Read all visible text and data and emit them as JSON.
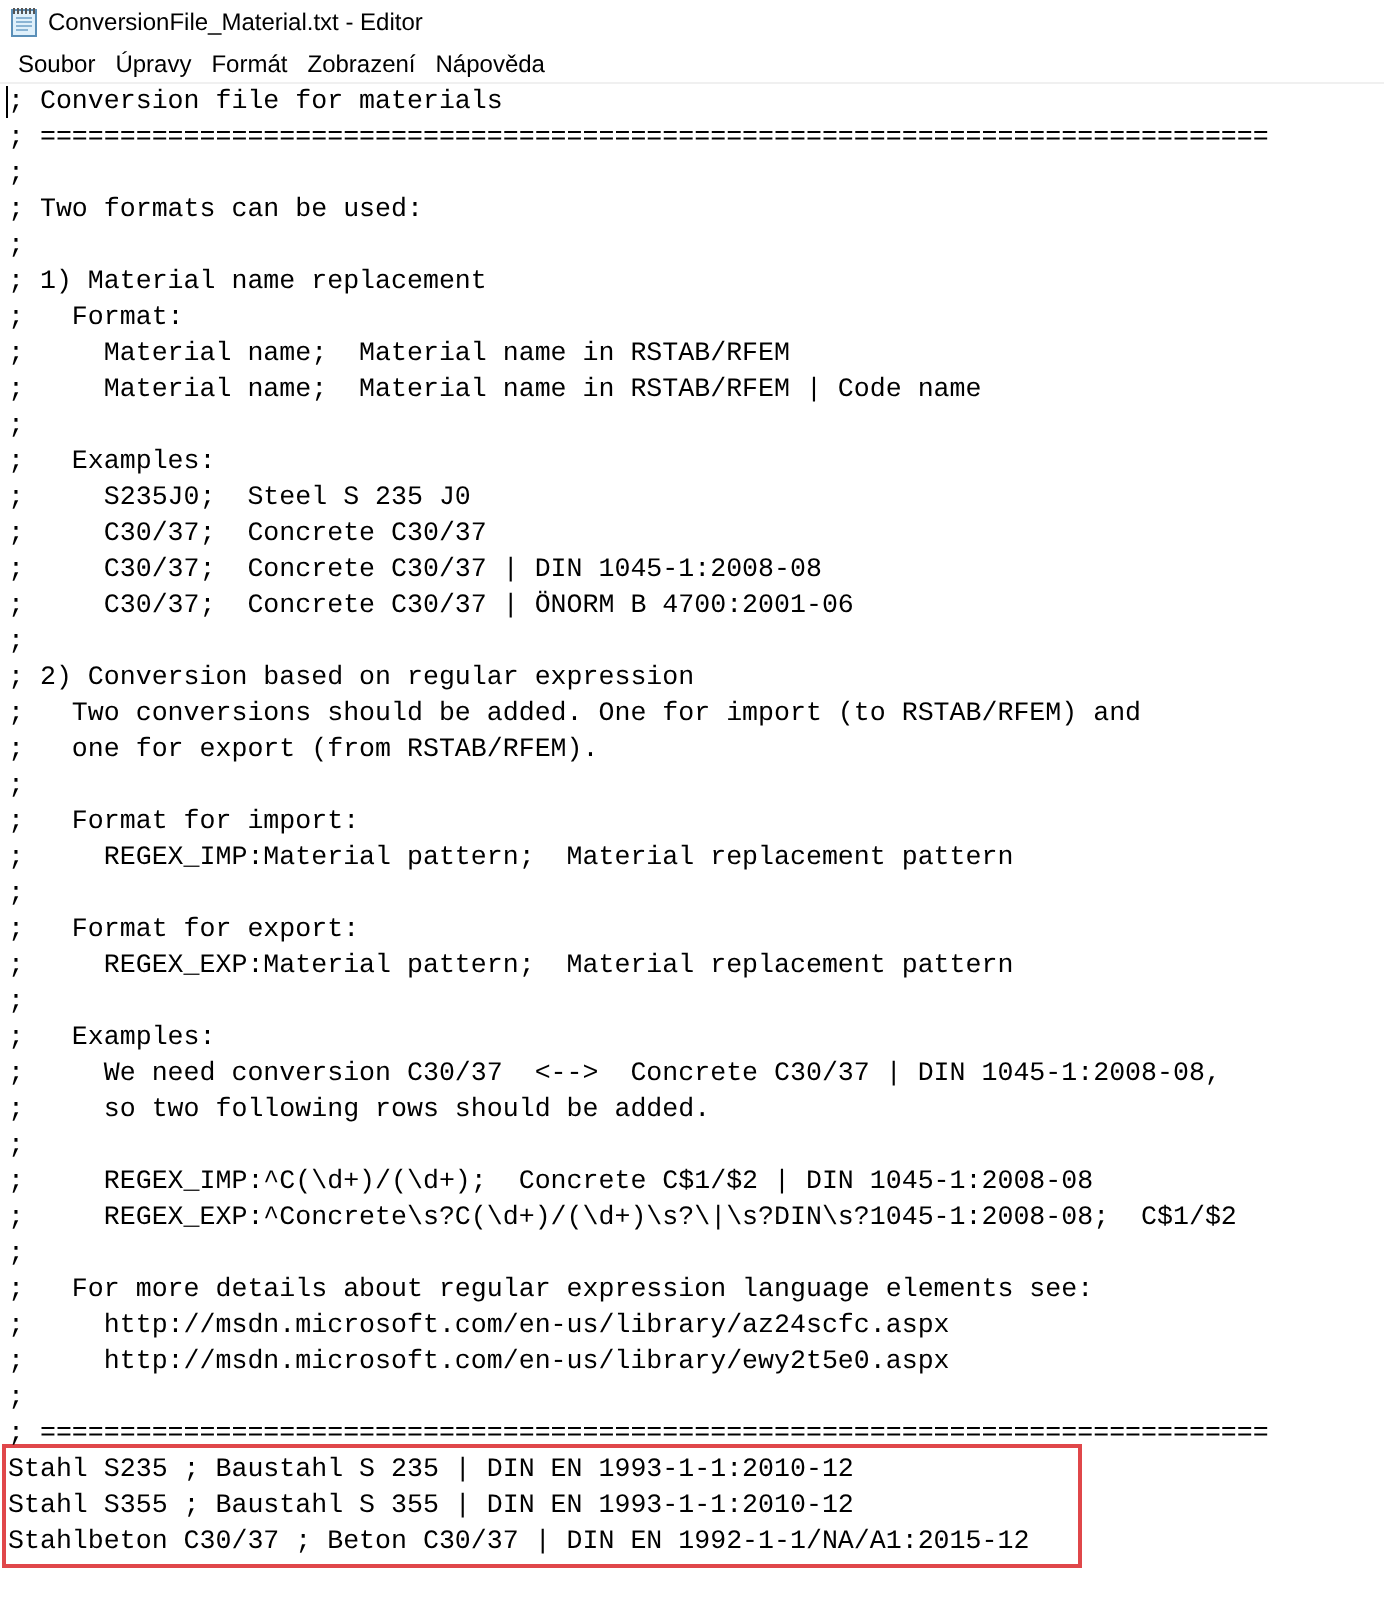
{
  "window": {
    "title": "ConversionFile_Material.txt - Editor"
  },
  "menu": [
    "Soubor",
    "Úpravy",
    "Formát",
    "Zobrazení",
    "Nápověda"
  ],
  "document": {
    "lines": [
      "; Conversion file for materials",
      "; =============================================================================",
      ";",
      "; Two formats can be used:",
      ";",
      "; 1) Material name replacement",
      ";   Format:",
      ";     Material name;  Material name in RSTAB/RFEM",
      ";     Material name;  Material name in RSTAB/RFEM | Code name",
      ";",
      ";   Examples:",
      ";     S235J0;  Steel S 235 J0",
      ";     C30/37;  Concrete C30/37",
      ";     C30/37;  Concrete C30/37 | DIN 1045-1:2008-08",
      ";     C30/37;  Concrete C30/37 | ÖNORM B 4700:2001-06",
      ";",
      "; 2) Conversion based on regular expression",
      ";   Two conversions should be added. One for import (to RSTAB/RFEM) and",
      ";   one for export (from RSTAB/RFEM).",
      ";",
      ";   Format for import:",
      ";     REGEX_IMP:Material pattern;  Material replacement pattern",
      ";",
      ";   Format for export:",
      ";     REGEX_EXP:Material pattern;  Material replacement pattern",
      ";",
      ";   Examples:",
      ";     We need conversion C30/37  <-->  Concrete C30/37 | DIN 1045-1:2008-08,",
      ";     so two following rows should be added.",
      ";",
      ";     REGEX_IMP:^C(\\d+)/(\\d+);  Concrete C$1/$2 | DIN 1045-1:2008-08",
      ";     REGEX_EXP:^Concrete\\s?C(\\d+)/(\\d+)\\s?\\|\\s?DIN\\s?1045-1:2008-08;  C$1/$2",
      ";",
      ";   For more details about regular expression language elements see:",
      ";     http://msdn.microsoft.com/en-us/library/az24scfc.aspx",
      ";     http://msdn.microsoft.com/en-us/library/ewy2t5e0.aspx",
      ";",
      "; ============================================================================="
    ]
  },
  "highlight_box": {
    "lines": [
      "Stahl S235 ; Baustahl S 235 | DIN EN 1993-1-1:2010-12",
      "Stahl S355 ; Baustahl S 355 | DIN EN 1993-1-1:2010-12",
      "Stahlbeton C30/37 ; Beton C30/37 | DIN EN 1992-1-1/NA/A1:2015-12"
    ]
  }
}
